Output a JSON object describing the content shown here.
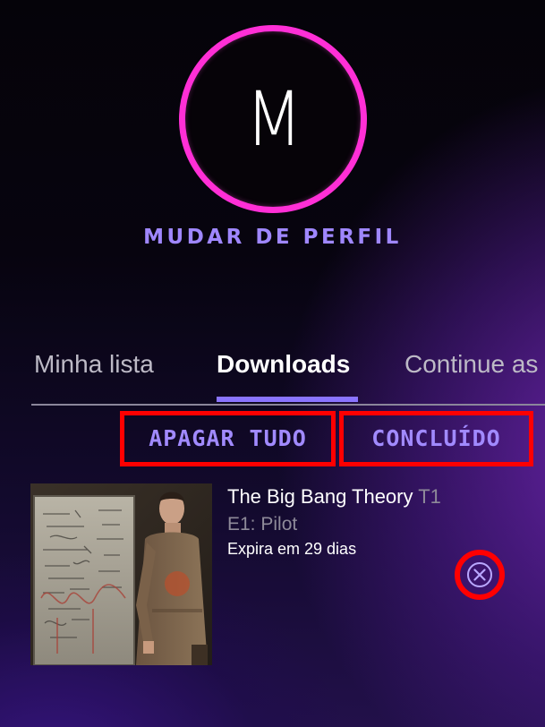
{
  "profile": {
    "avatar_letter": "M",
    "change_profile_label": "MUDAR DE PERFIL",
    "ring_color": "#ff2fd6"
  },
  "tabs": [
    {
      "label": "Minha lista",
      "active": false
    },
    {
      "label": "Downloads",
      "active": true
    },
    {
      "label": "Continue as",
      "active": false
    }
  ],
  "actions": {
    "delete_all_label": "APAGAR TUDO",
    "done_label": "CONCLUÍDO"
  },
  "downloads": [
    {
      "title": "The Big Bang Theory",
      "season": "T1",
      "episode": "E1: Pilot",
      "expiry": "Expira em 29 dias",
      "thumbnail_icon": "episode-thumbnail",
      "remove_icon": "close-circle-icon"
    }
  ],
  "colors": {
    "accent": "#9f87ff",
    "tab_indicator": "#8a74ff",
    "highlight_box": "#ff0000",
    "muted_text": "#8e8a99"
  }
}
